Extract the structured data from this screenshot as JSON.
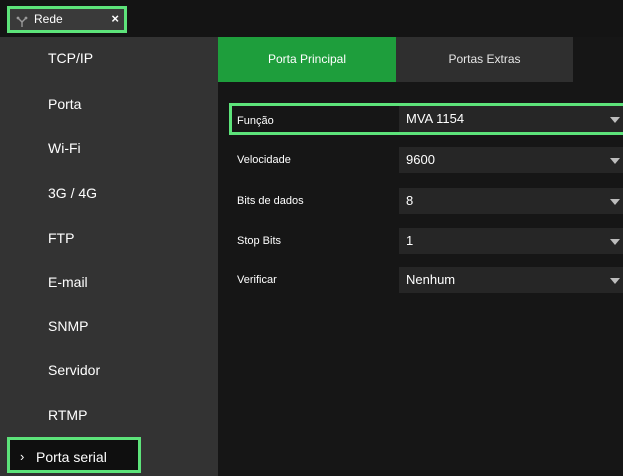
{
  "tab": {
    "label": "Rede",
    "close": "×"
  },
  "sidebar": {
    "items": [
      {
        "label": "TCP/IP"
      },
      {
        "label": "Porta"
      },
      {
        "label": "Wi-Fi"
      },
      {
        "label": "3G / 4G"
      },
      {
        "label": "FTP"
      },
      {
        "label": "E-mail"
      },
      {
        "label": "SNMP"
      },
      {
        "label": "Servidor"
      },
      {
        "label": "RTMP"
      },
      {
        "label": "Porta serial",
        "chevron": "›"
      }
    ]
  },
  "main": {
    "tabs": [
      {
        "label": "Porta Principal"
      },
      {
        "label": "Portas Extras"
      }
    ],
    "fields": [
      {
        "label": "Função",
        "value": "MVA 1154"
      },
      {
        "label": "Velocidade",
        "value": "9600"
      },
      {
        "label": "Bits de dados",
        "value": "8"
      },
      {
        "label": "Stop Bits",
        "value": "1"
      },
      {
        "label": "Verificar",
        "value": "Nenhum"
      }
    ]
  },
  "colors": {
    "accent": "#1e9e3c",
    "highlight": "#5de37a",
    "sidebar": "#333333",
    "background": "#161616"
  },
  "icons": {
    "tab": "network-icon",
    "dropdown": "caret-down-icon"
  }
}
